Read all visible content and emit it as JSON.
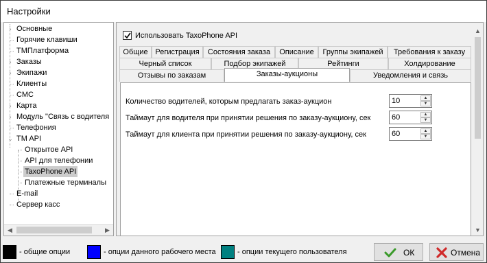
{
  "window": {
    "title": "Настройки"
  },
  "tree": {
    "items": [
      {
        "label": "Основные",
        "expander": "›"
      },
      {
        "label": "Горячие клавиши",
        "expander": ""
      },
      {
        "label": "ТМПлатформа",
        "expander": ""
      },
      {
        "label": "Заказы",
        "expander": "›"
      },
      {
        "label": "Экипажи",
        "expander": "›"
      },
      {
        "label": "Клиенты",
        "expander": ""
      },
      {
        "label": "СМС",
        "expander": ""
      },
      {
        "label": "Карта",
        "expander": "›"
      },
      {
        "label": "Модуль \"Связь с водителя",
        "expander": "›"
      },
      {
        "label": "Телефония",
        "expander": ""
      },
      {
        "label": "TM API",
        "expander": "⌄"
      },
      {
        "label": "Открытое API",
        "expander": ""
      },
      {
        "label": "API для телефонии",
        "expander": ""
      },
      {
        "label": "TaxoPhone API",
        "expander": ""
      },
      {
        "label": "Платежные терминалы",
        "expander": ""
      },
      {
        "label": "E-mail",
        "expander": ""
      },
      {
        "label": "Сервер касс",
        "expander": ""
      }
    ],
    "selected": "TaxoPhone API"
  },
  "settings": {
    "use_api_label": "Использовать TaxoPhone API",
    "use_api_checked": true
  },
  "tabs": {
    "row1": [
      "Общие",
      "Регистрация",
      "Состояния заказа",
      "Описание",
      "Группы экипажей",
      "Требования к заказу"
    ],
    "row2": [
      "Черный список",
      "Подбор экипажей",
      "Рейтинги",
      "Холдирование"
    ],
    "row3": [
      "Отзывы по заказам",
      "Заказы-аукционы",
      "Уведомления и связь"
    ],
    "active": "Заказы-аукционы"
  },
  "fields": [
    {
      "label": "Количество водителей, которым предлагать заказ-аукцион",
      "value": "10"
    },
    {
      "label": "Таймаут для водителя при принятии решения по заказу-аукциону, сек",
      "value": "60"
    },
    {
      "label": "Таймаут для клиента при принятии решения по заказу-аукциону, сек",
      "value": "60"
    }
  ],
  "legend": [
    {
      "label": "- общие опции",
      "color": "#000000"
    },
    {
      "label": "- опции данного рабочего места",
      "color": "#0000ff"
    },
    {
      "label": "- опции текущего пользователя",
      "color": "#008080"
    }
  ],
  "buttons": {
    "ok": "ОК",
    "cancel": "Отмена"
  }
}
